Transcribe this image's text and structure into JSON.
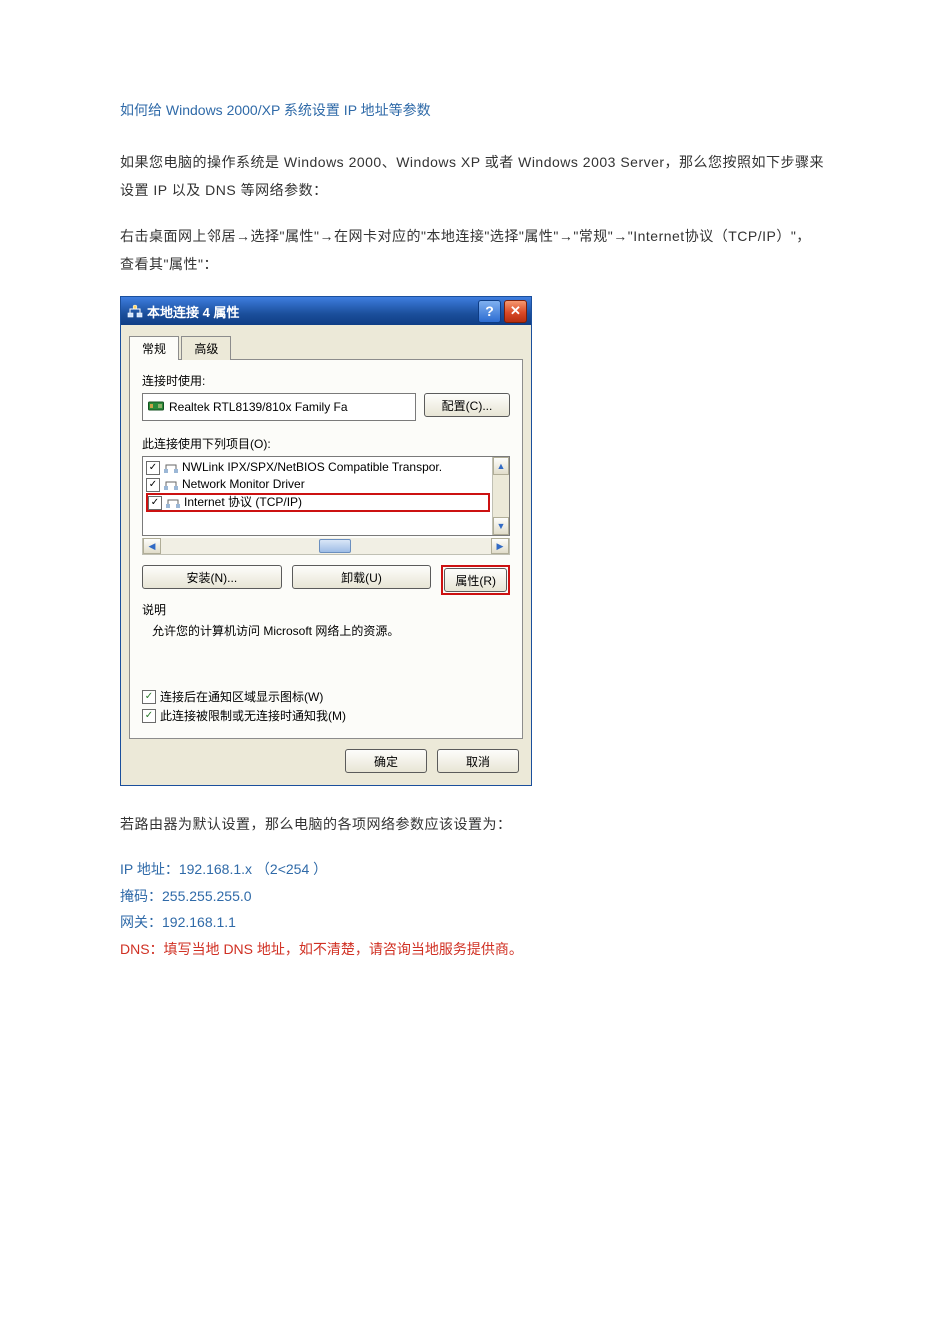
{
  "doc": {
    "heading": "如何给 Windows 2000/XP 系统设置 IP 地址等参数",
    "para1": "如果您电脑的操作系统是 Windows 2000、Windows XP 或者 Windows 2003 Server，那么您按照如下步骤来设置 IP 以及 DNS 等网络参数：",
    "para2": "右击桌面网上邻居→选择\"属性\"→在网卡对应的\"本地连接\"选择\"属性\"→\"常规\"→\"Internet协议（TCP/IP）\"，查看其\"属性\"：",
    "para3": "若路由器为默认设置，那么电脑的各项网络参数应该设置为：",
    "params": {
      "ip": "IP 地址：192.168.1.x  （2<254                                   ）",
      "mask": "掩码：255.255.255.0",
      "gw": "网关：192.168.1.1",
      "dns": "DNS：填写当地 DNS 地址，如不清楚，请咨询当地服务提供商。"
    }
  },
  "dialog": {
    "title": "本地连接 4 属性",
    "help": "?",
    "close": "✕",
    "tabs": {
      "general": "常规",
      "advanced": "高级"
    },
    "connect_using": "连接时使用:",
    "adapter": "Realtek RTL8139/810x Family Fa",
    "configure_btn": "配置(C)...",
    "items_label": "此连接使用下列项目(O):",
    "items": {
      "i1": "NWLink IPX/SPX/NetBIOS Compatible Transpor.",
      "i2": "Network Monitor Driver",
      "i3": "Internet 协议 (TCP/IP)"
    },
    "install_btn": "安装(N)...",
    "uninstall_btn": "卸载(U)",
    "properties_btn": "属性(R)",
    "desc_label": "说明",
    "desc_text": "允许您的计算机访问 Microsoft 网络上的资源。",
    "chk1": "连接后在通知区域显示图标(W)",
    "chk2": "此连接被限制或无连接时通知我(M)",
    "ok": "确定",
    "cancel": "取消",
    "checkmark": "✓",
    "arrow_up": "▲",
    "arrow_down": "▼",
    "arrow_left": "◀",
    "arrow_right": "▶"
  }
}
